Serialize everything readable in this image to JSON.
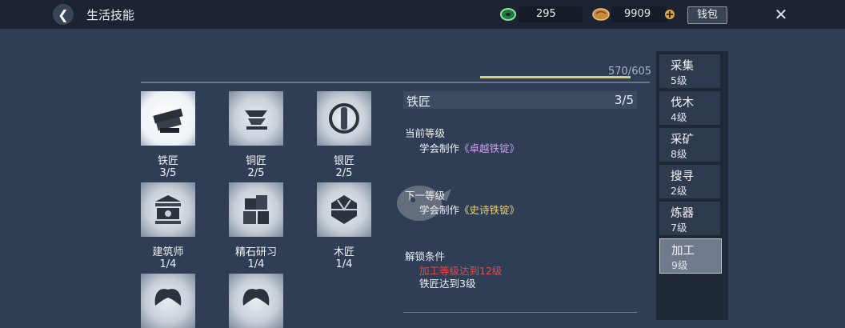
{
  "header": {
    "title": "生活技能",
    "currency1": "295",
    "currency2": "9909",
    "wallet_label": "钱包"
  },
  "progress": {
    "text": "570/605",
    "current": 570,
    "max": 605
  },
  "skills": [
    {
      "name": "铁匠",
      "level": "3/5"
    },
    {
      "name": "铜匠",
      "level": "2/5"
    },
    {
      "name": "银匠",
      "level": "2/5"
    },
    {
      "name": "建筑师",
      "level": "1/4"
    },
    {
      "name": "精石研习",
      "level": "1/4"
    },
    {
      "name": "木匠",
      "level": "1/4"
    },
    {
      "name": "",
      "level": ""
    },
    {
      "name": "",
      "level": ""
    }
  ],
  "detail": {
    "name": "铁匠",
    "level": "3/5",
    "current_title": "当前等级",
    "current_prefix": "学会制作",
    "current_item": "《卓越铁锭》",
    "next_title": "下一等级",
    "next_prefix": "学会制作",
    "next_item": "《史诗铁锭》",
    "unlock_title": "解锁条件",
    "unlock_req1": "加工等级达到12级",
    "unlock_req2": "铁匠达到3级"
  },
  "sidebar": [
    {
      "name": "采集",
      "level": "5级"
    },
    {
      "name": "伐木",
      "level": "4级"
    },
    {
      "name": "采矿",
      "level": "8级"
    },
    {
      "name": "搜寻",
      "level": "2级"
    },
    {
      "name": "炼器",
      "level": "7级"
    },
    {
      "name": "加工",
      "level": "9级"
    }
  ],
  "colors": {
    "accent_yellow": "#d7d36a",
    "red": "#e14b4b",
    "purple": "#c8a5ea"
  }
}
